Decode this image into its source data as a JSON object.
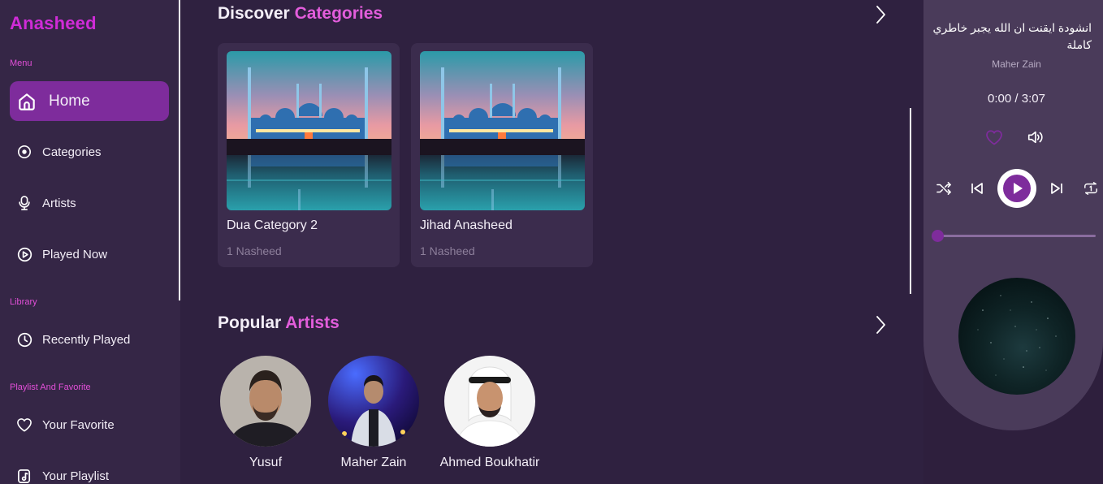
{
  "app": {
    "logo": "Anasheed"
  },
  "sidebar": {
    "menu_label": "Menu",
    "library_label": "Library",
    "playlist_label": "Playlist And Favorite",
    "items": [
      {
        "label": "Home",
        "icon": "home-icon",
        "active": true
      },
      {
        "label": "Categories",
        "icon": "categories-icon"
      },
      {
        "label": "Artists",
        "icon": "microphone-icon"
      },
      {
        "label": "Played Now",
        "icon": "play-circle-icon"
      },
      {
        "label": "Recently Played",
        "icon": "clock-icon"
      },
      {
        "label": "Your Favorite",
        "icon": "heart-icon"
      },
      {
        "label": "Your Playlist",
        "icon": "playlist-icon"
      }
    ]
  },
  "main": {
    "categories_section": {
      "title_prefix": "Discover",
      "title_accent": "Categories"
    },
    "categories": [
      {
        "name": "Dua Category 2",
        "count": "1 Nasheed"
      },
      {
        "name": "Jihad Anasheed",
        "count": "1 Nasheed"
      }
    ],
    "artists_section": {
      "title_prefix": "Popular",
      "title_accent": "Artists"
    },
    "artists": [
      {
        "name": "Yusuf"
      },
      {
        "name": "Maher Zain"
      },
      {
        "name": "Ahmed Boukhatir"
      }
    ]
  },
  "player": {
    "track_title": "انشودة ايقنت ان الله يجبر خاطري كاملة",
    "artist": "Maher Zain",
    "time": "0:00 / 3:07",
    "progress": 0,
    "icons": [
      "heart-icon",
      "volume-icon",
      "shuffle-icon",
      "previous-icon",
      "play-icon",
      "next-icon",
      "repeat-icon"
    ]
  },
  "colors": {
    "accent": "#7e2c9c",
    "pink": "#e25ddb",
    "logo": "#d02bd8",
    "background": "#2f2140"
  }
}
